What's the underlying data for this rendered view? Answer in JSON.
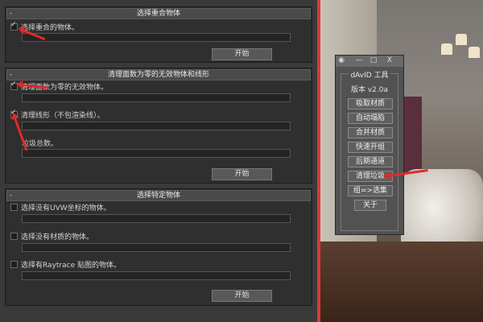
{
  "panel1": {
    "title": "选择重合物体",
    "checkbox_label": "选择重合的物体。",
    "start_label": "开始"
  },
  "panel2": {
    "title": "清理面数为零的无效物体和线形",
    "checkbox1_label": "清理面数为零的无效物体。",
    "checkbox2_label": "清理线形（不包渲染线）。",
    "total_label": "垃圾总数。",
    "start_label": "开始"
  },
  "panel3": {
    "title": "选择特定物体",
    "opt1_label": "选择没有UVW坐标的物体。",
    "opt2_label": "选择没有材质的物体。",
    "opt3_label": "选择有Raytrace 贴图的物体。",
    "start_label": "开始"
  },
  "window_controls": {
    "minimize": "—",
    "maximize": "□",
    "close": "X"
  },
  "toolbox": {
    "title": "dAvID 工具",
    "version": "版本 v2.0a",
    "buttons": [
      "吸取材质",
      "自动塌陷",
      "合并材质",
      "快速开组",
      "后期通道",
      "清理垃圾",
      "组=>选集",
      "关于"
    ]
  },
  "colors": {
    "accent_red": "#e02a2a",
    "panel_bg": "#2f2f2f"
  }
}
